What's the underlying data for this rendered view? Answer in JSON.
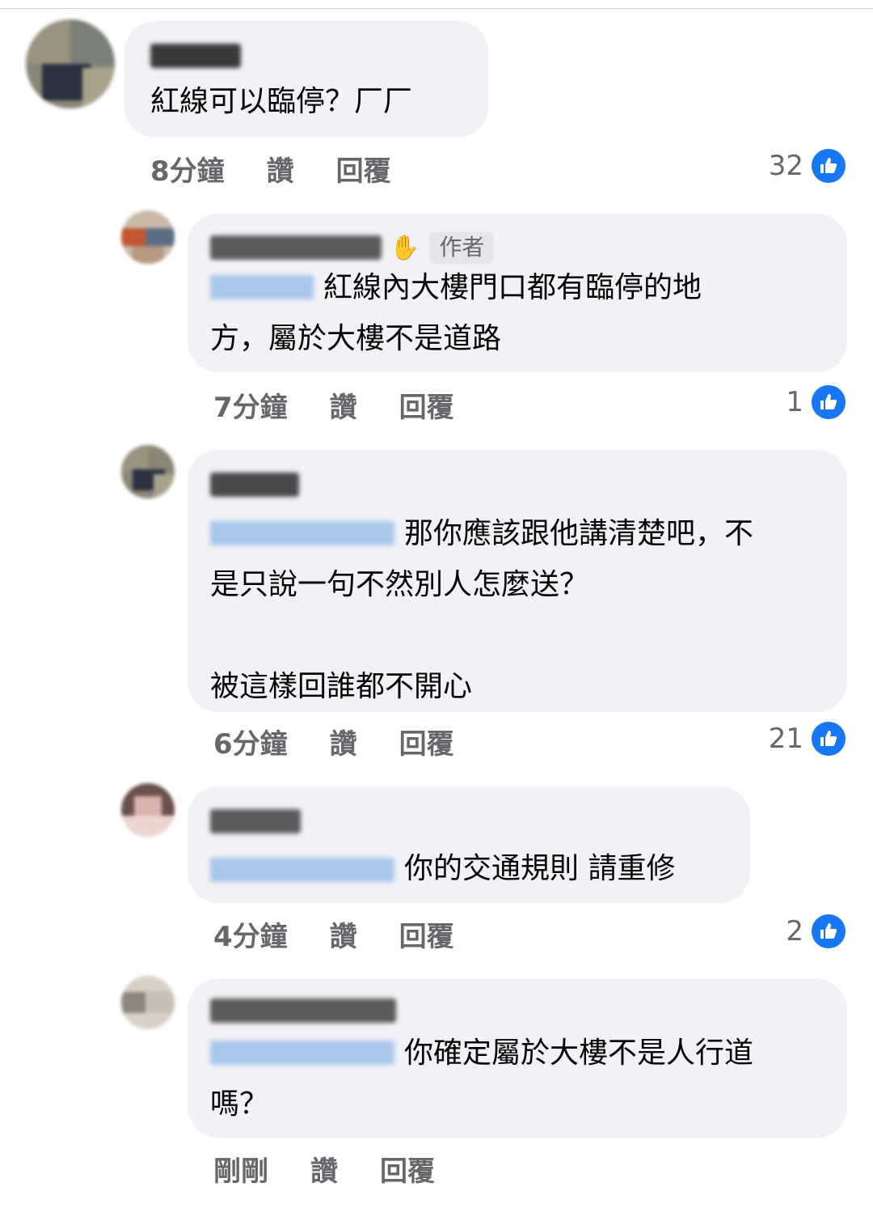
{
  "comments": [
    {
      "text": "紅線可以臨停？厂厂",
      "time": "8分鐘",
      "like_label": "讚",
      "reply_label": "回覆",
      "likes": "32"
    },
    {
      "author_badge": "作者",
      "text": "紅線內大樓門口都有臨停的地\n方，屬於大樓不是道路",
      "time": "7分鐘",
      "like_label": "讚",
      "reply_label": "回覆",
      "likes": "1"
    },
    {
      "text": "那你應該跟他講清楚吧，不\n是只說一句不然別人怎麼送？\n\n被這樣回誰都不開心",
      "time": "6分鐘",
      "like_label": "讚",
      "reply_label": "回覆",
      "likes": "21"
    },
    {
      "text": "你的交通規則 請重修",
      "time": "4分鐘",
      "like_label": "讚",
      "reply_label": "回覆",
      "likes": "2"
    },
    {
      "text": "你確定屬於大樓不是人行道\n嗎？",
      "time": "剛剛",
      "like_label": "讚",
      "reply_label": "回覆"
    }
  ],
  "colors": {
    "bubble": "#f0f2f5",
    "meta_text": "#65676b",
    "like_blue": "#1877f2"
  }
}
